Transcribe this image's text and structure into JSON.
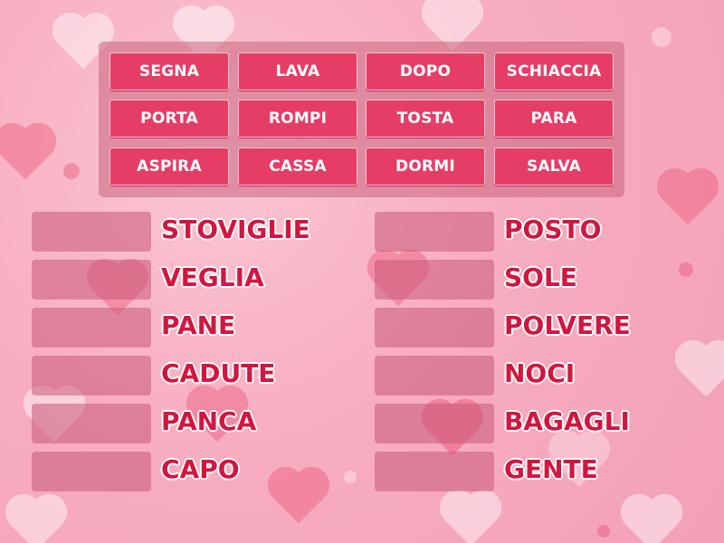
{
  "tiles": [
    {
      "label": "SEGNA"
    },
    {
      "label": "LAVA"
    },
    {
      "label": "DOPO"
    },
    {
      "label": "SCHIACCIA"
    },
    {
      "label": "PORTA"
    },
    {
      "label": "ROMPI"
    },
    {
      "label": "TOSTA"
    },
    {
      "label": "PARA"
    },
    {
      "label": "ASPIRA"
    },
    {
      "label": "CASSA"
    },
    {
      "label": "DORMI"
    },
    {
      "label": "SALVA"
    }
  ],
  "targets_left": [
    {
      "word": "STOVIGLIE"
    },
    {
      "word": "VEGLIA"
    },
    {
      "word": "PANE"
    },
    {
      "word": "CADUTE"
    },
    {
      "word": "PANCA"
    },
    {
      "word": "CAPO"
    }
  ],
  "targets_right": [
    {
      "word": "POSTO"
    },
    {
      "word": "SOLE"
    },
    {
      "word": "POLVERE"
    },
    {
      "word": "NOCI"
    },
    {
      "word": "BAGAGLI"
    },
    {
      "word": "GENTE"
    }
  ],
  "colors": {
    "tile": "#e63d66",
    "word": "#d1163f",
    "background": "#f7adc0"
  },
  "icons": {
    "background_decoration": "heart-icon"
  }
}
